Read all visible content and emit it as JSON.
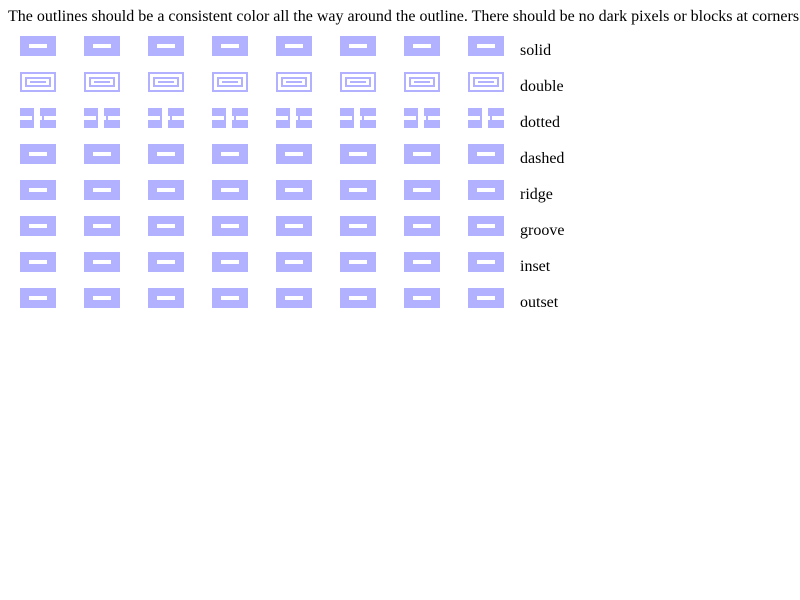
{
  "intro_text": "The outlines should be a consistent color all the way around the outline. There should be no dark pixels or blocks at corners.",
  "outline_color": "#b1b1ff",
  "inner_color": "#ffffff",
  "swatches_per_row": 8,
  "rows": [
    {
      "style": "solid",
      "label": "solid"
    },
    {
      "style": "double",
      "label": "double"
    },
    {
      "style": "dotted",
      "label": "dotted"
    },
    {
      "style": "dashed",
      "label": "dashed"
    },
    {
      "style": "ridge",
      "label": "ridge"
    },
    {
      "style": "groove",
      "label": "groove"
    },
    {
      "style": "inset",
      "label": "inset"
    },
    {
      "style": "outset",
      "label": "outset"
    }
  ]
}
